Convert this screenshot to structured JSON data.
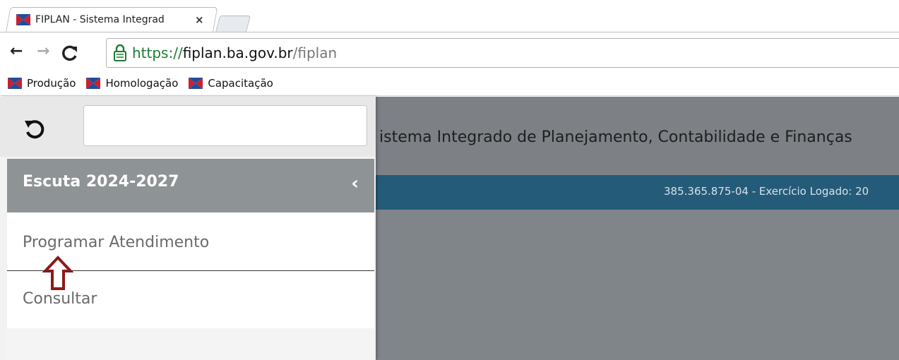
{
  "browser": {
    "tab_title": "FIPLAN - Sistema Integrad",
    "tab_close": "×",
    "url_protocol": "https://",
    "url_host": "fiplan.ba.gov.br",
    "url_path": "/fiplan",
    "nav_icons": [
      "back-arrow-icon",
      "forward-arrow-icon",
      "reload-icon"
    ],
    "bookmarks": [
      "Produção",
      "Homologação",
      "Capacitação"
    ]
  },
  "app": {
    "title": "istema Integrado de Planejamento, Contabilidade e Finanças",
    "user_info": "385.365.875-04 - Exercício Logado: 20"
  },
  "sidemenu": {
    "search_value": "",
    "section_title": "Escuta 2024-2027",
    "items": [
      "Programar Atendimento",
      "Consultar"
    ]
  },
  "colors": {
    "user_bar": "#245b78",
    "section_header": "#8e9395",
    "overlay": "#80858a",
    "annotation_arrow": "#8b1a1a"
  }
}
